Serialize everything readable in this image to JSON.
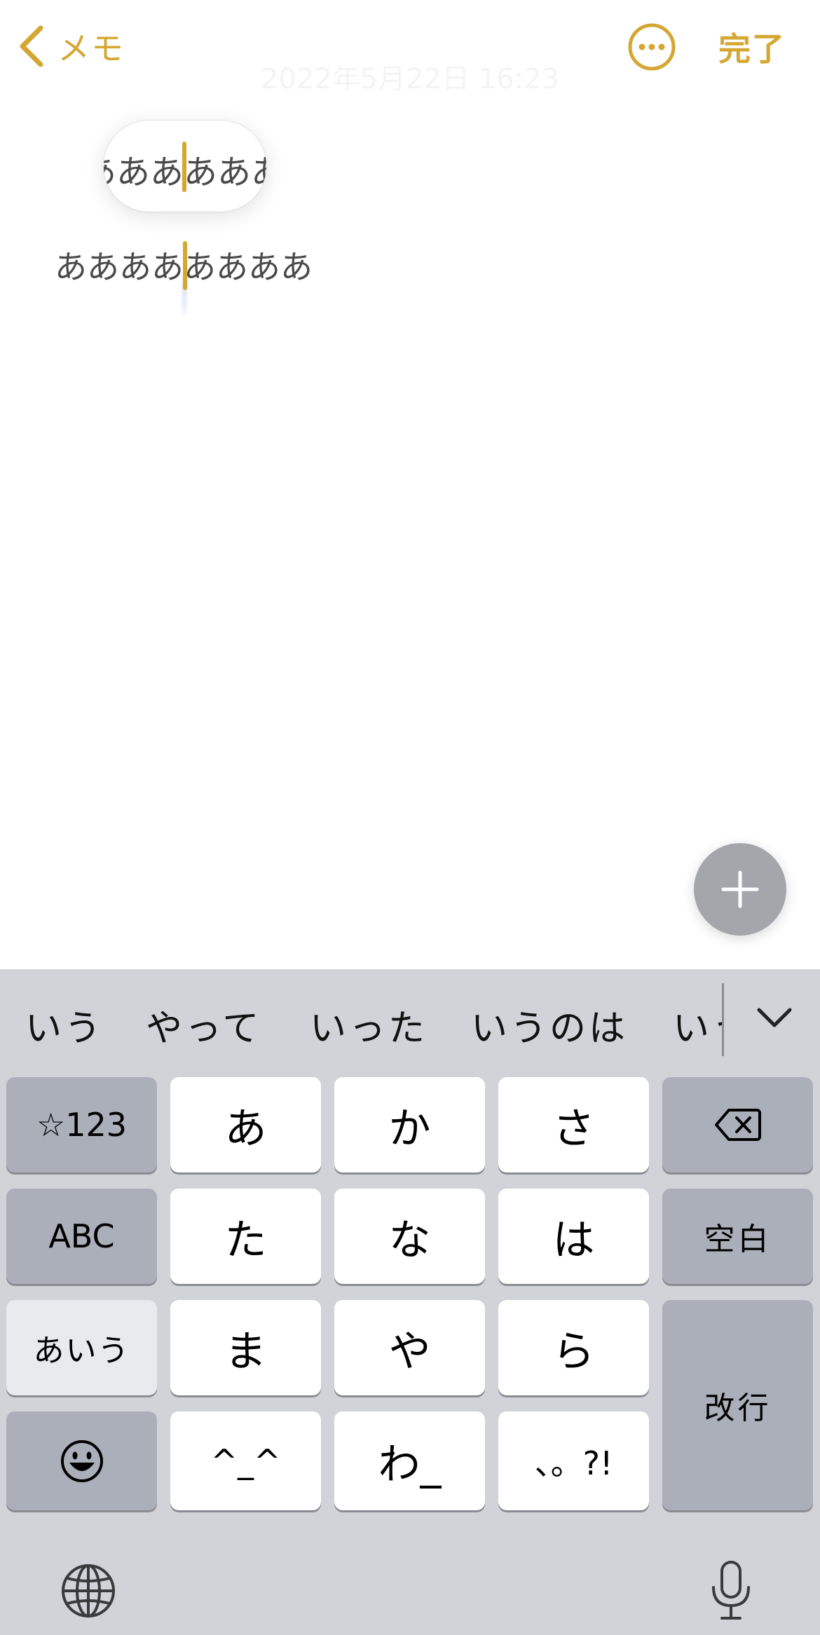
{
  "nav": {
    "back_label": "メモ",
    "done_label": "完了"
  },
  "note": {
    "date": "2022年5月22日 16:23",
    "text": "ああああああああ",
    "loupe_text": "あああああああ"
  },
  "predictions": [
    "いう",
    "やって",
    "いった",
    "いうのは",
    "いう"
  ],
  "keyboard": {
    "rows": [
      [
        "☆123",
        "あ",
        "か",
        "さ",
        ""
      ],
      [
        "ABC",
        "た",
        "な",
        "は",
        "空白"
      ],
      [
        "あいう",
        "ま",
        "や",
        "ら",
        "改行"
      ],
      [
        "",
        "^_^",
        "わ_",
        "、。?!"
      ]
    ]
  },
  "colors": {
    "accent": "#D5A732",
    "keyboard_bg": "#d1d3d9",
    "key_white": "#ffffff",
    "key_gray": "#abafba"
  },
  "icons": {
    "back": "chevron-left-icon",
    "more": "ellipsis-circle-icon",
    "fab": "plus-icon",
    "collapse": "chevron-down-icon",
    "delete": "delete-backward-icon",
    "emoji": "emoji-face-icon",
    "globe": "globe-icon",
    "mic": "microphone-icon"
  }
}
